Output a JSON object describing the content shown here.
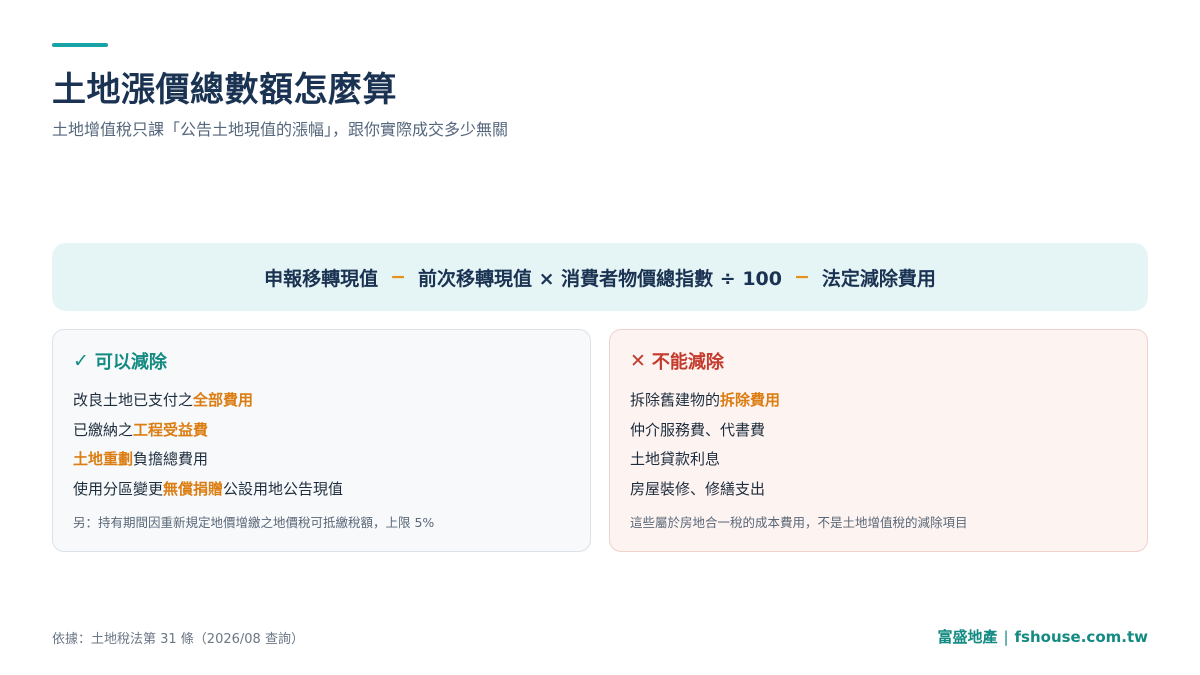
{
  "header": {
    "title": "土地漲價總數額怎麼算",
    "subtitle": "土地增值稅只課「公告土地現值的漲幅」，跟你實際成交多少無關"
  },
  "formula": {
    "part1": "申報移轉現值",
    "op1": "−",
    "part2": "前次移轉現值 × 消費者物價總指數 ÷ 100",
    "op2": "−",
    "part3": "法定減除費用"
  },
  "can_deduct": {
    "icon": "check-icon",
    "icon_glyph": "✓",
    "title": "可以減除",
    "items": [
      {
        "pre": "改良土地已支付之",
        "hl": "全部費用",
        "post": ""
      },
      {
        "pre": "已繳納之",
        "hl": "工程受益費",
        "post": ""
      },
      {
        "pre": "",
        "hl": "土地重劃",
        "post": "負擔總費用"
      },
      {
        "pre": "使用分區變更",
        "hl": "無償捐贈",
        "post": "公設用地公告現值"
      }
    ],
    "note": "另：持有期間因重新規定地價增繳之地價稅可抵繳稅額，上限 5%"
  },
  "cannot_deduct": {
    "icon": "close-icon",
    "icon_glyph": "✕",
    "title": "不能減除",
    "items": [
      {
        "pre": "拆除舊建物的",
        "hl": "拆除費用",
        "post": ""
      },
      {
        "pre": "仲介服務費、代書費",
        "hl": "",
        "post": ""
      },
      {
        "pre": "土地貸款利息",
        "hl": "",
        "post": ""
      },
      {
        "pre": "房屋裝修、修繕支出",
        "hl": "",
        "post": ""
      }
    ],
    "note": "這些屬於房地合一稅的成本費用，不是土地增值稅的減除項目"
  },
  "footer": {
    "source": "依據：土地稅法第 31 條（2026/08 查詢）",
    "brand_name": "富盛地產",
    "brand_sep": "|",
    "brand_url": "fshouse.com.tw"
  },
  "colors": {
    "accent": "#18a3a8",
    "highlight": "#dc7d12",
    "positive": "#138a82",
    "negative": "#c43a2c"
  }
}
